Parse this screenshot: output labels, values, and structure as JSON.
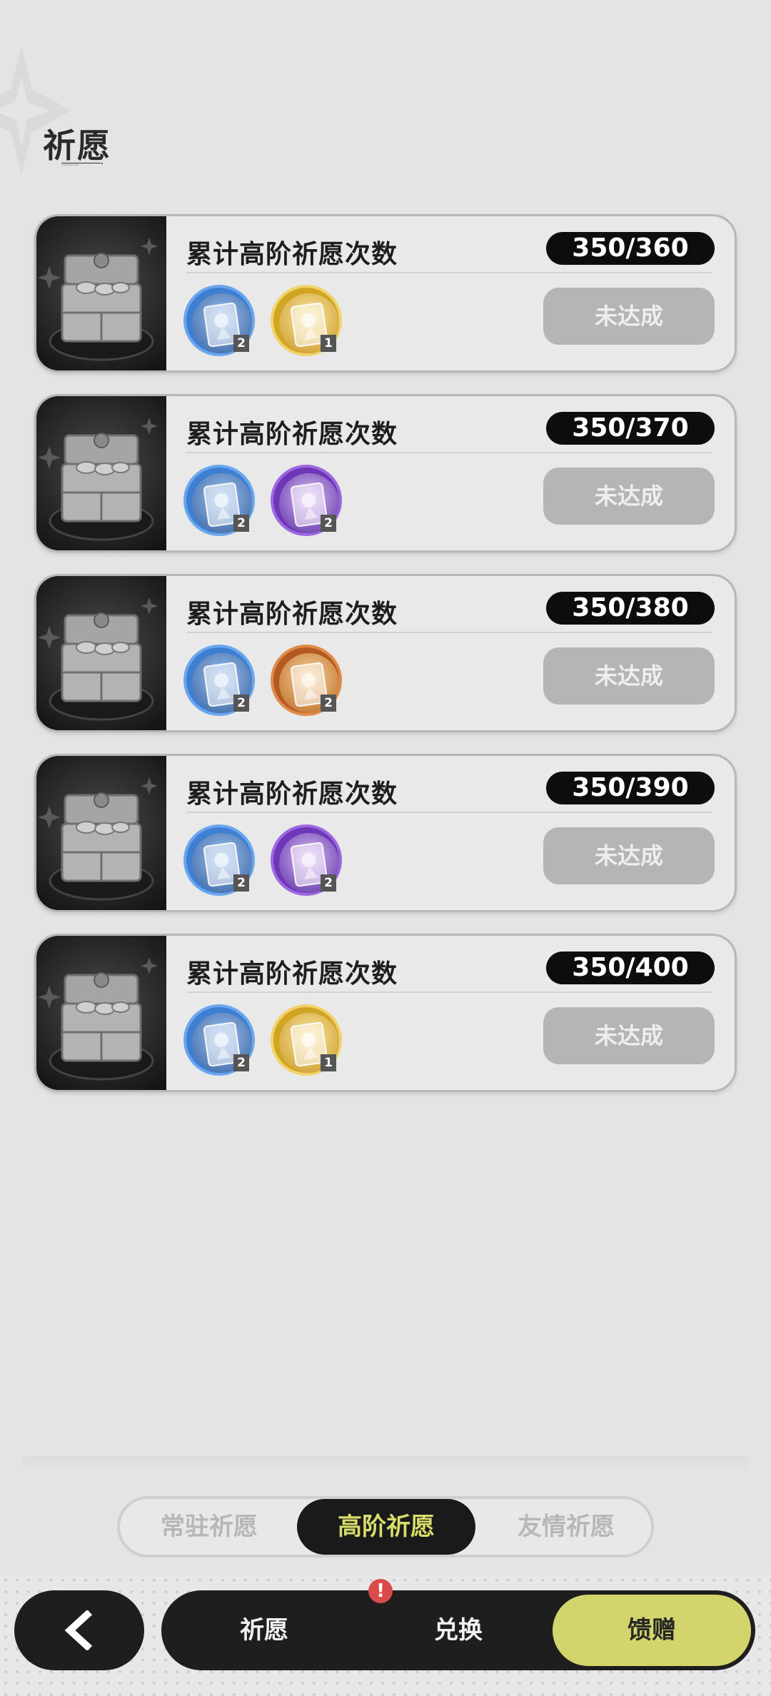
{
  "page": {
    "title": "祈愿",
    "background": "#e4e4e4"
  },
  "milestones": [
    {
      "label": "累计高阶祈愿次数",
      "progress": "350/360",
      "status": "未达成",
      "rewards": [
        {
          "icon": "blue-card-icon",
          "color": "blue",
          "count": "2"
        },
        {
          "icon": "gold-card-icon",
          "color": "gold",
          "count": "1"
        }
      ]
    },
    {
      "label": "累计高阶祈愿次数",
      "progress": "350/370",
      "status": "未达成",
      "rewards": [
        {
          "icon": "blue-card-icon",
          "color": "blue",
          "count": "2"
        },
        {
          "icon": "purple-card-icon",
          "color": "purple",
          "count": "2"
        }
      ]
    },
    {
      "label": "累计高阶祈愿次数",
      "progress": "350/380",
      "status": "未达成",
      "rewards": [
        {
          "icon": "blue-card-icon",
          "color": "blue",
          "count": "2"
        },
        {
          "icon": "orange-card-icon",
          "color": "orange",
          "count": "2"
        }
      ]
    },
    {
      "label": "累计高阶祈愿次数",
      "progress": "350/390",
      "status": "未达成",
      "rewards": [
        {
          "icon": "blue-card-icon",
          "color": "blue",
          "count": "2"
        },
        {
          "icon": "purple-card-icon",
          "color": "purple",
          "count": "2"
        }
      ]
    },
    {
      "label": "累计高阶祈愿次数",
      "progress": "350/400",
      "status": "未达成",
      "rewards": [
        {
          "icon": "blue-card-icon",
          "color": "blue",
          "count": "2"
        },
        {
          "icon": "gold-card-icon",
          "color": "gold",
          "count": "1"
        }
      ]
    }
  ],
  "tabs": [
    {
      "label": "常驻祈愿",
      "active": false
    },
    {
      "label": "高阶祈愿",
      "active": true
    },
    {
      "label": "友情祈愿",
      "active": false
    }
  ],
  "nav": {
    "back_icon": "chevron-left-icon",
    "items": [
      {
        "label": "祈愿",
        "alert": "!"
      },
      {
        "label": "兑换"
      },
      {
        "label": "馈赠",
        "active": true
      }
    ],
    "active_color": "#d3d56c"
  }
}
